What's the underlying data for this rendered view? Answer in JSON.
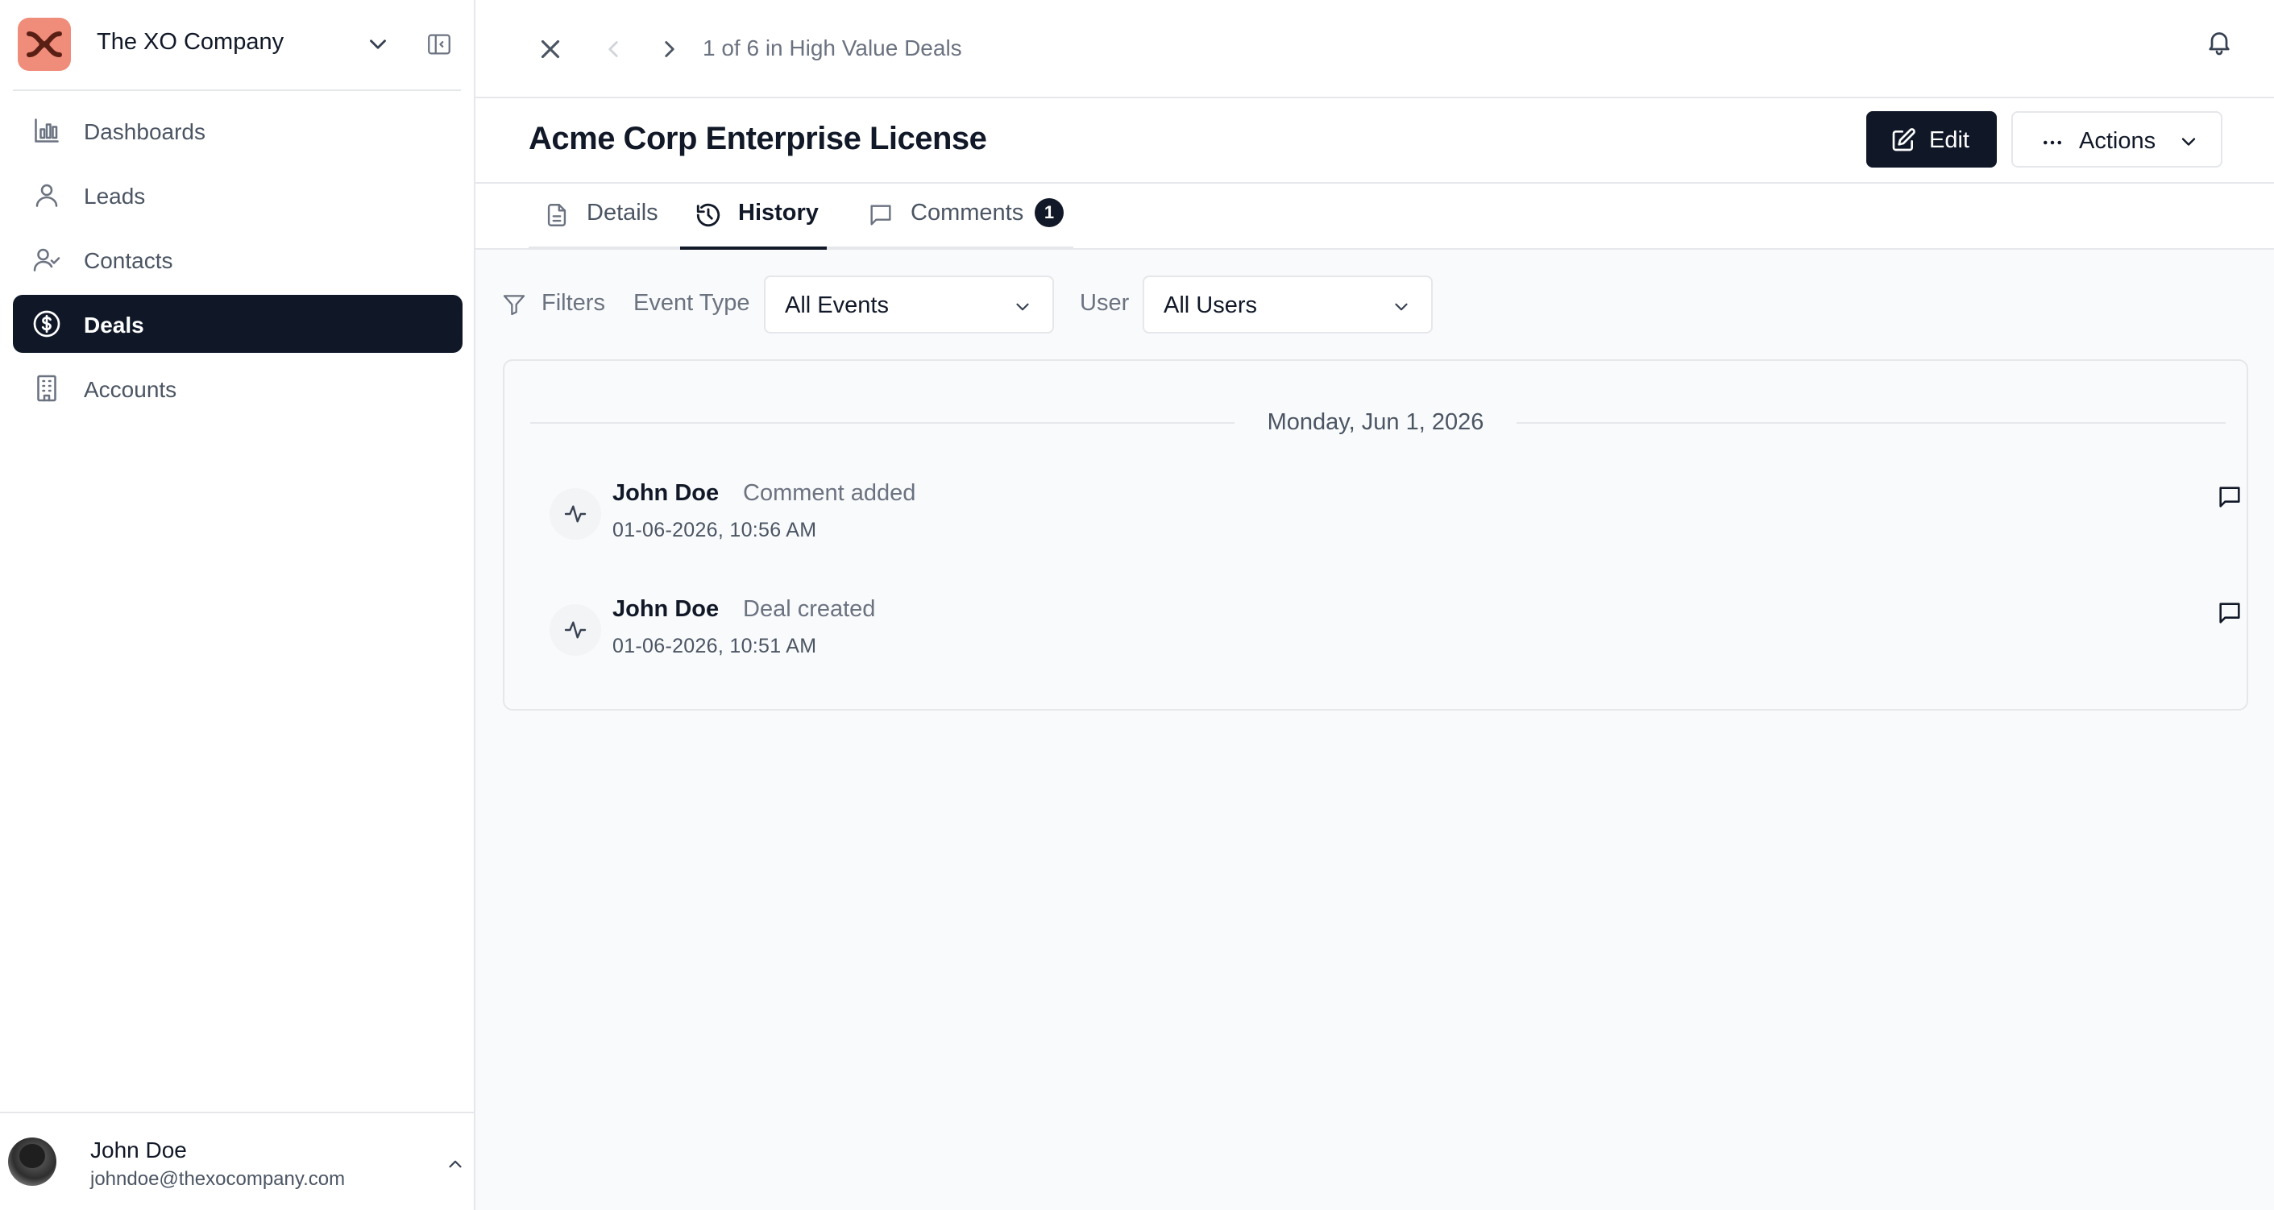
{
  "workspace": {
    "name": "The XO Company"
  },
  "sidebar": {
    "items": [
      {
        "label": "Dashboards",
        "icon": "bar-chart-icon",
        "active": false
      },
      {
        "label": "Leads",
        "icon": "user-icon",
        "active": false
      },
      {
        "label": "Contacts",
        "icon": "user-check-icon",
        "active": false
      },
      {
        "label": "Deals",
        "icon": "dollar-circle-icon",
        "active": true
      },
      {
        "label": "Accounts",
        "icon": "building-icon",
        "active": false
      }
    ]
  },
  "user": {
    "name": "John Doe",
    "email": "johndoe@thexocompany.com"
  },
  "topbar": {
    "record_position": "1 of 6 in High Value Deals"
  },
  "record": {
    "title": "Acme Corp Enterprise License"
  },
  "header_actions": {
    "edit_label": "Edit",
    "actions_label": "Actions"
  },
  "tabs": [
    {
      "label": "Details",
      "icon": "document-icon",
      "active": false
    },
    {
      "label": "History",
      "icon": "history-icon",
      "active": true
    },
    {
      "label": "Comments",
      "icon": "comment-icon",
      "active": false,
      "badge": "1"
    }
  ],
  "filters": {
    "label": "Filters",
    "event_type_label": "Event Type",
    "event_type_value": "All Events",
    "user_label": "User",
    "user_value": "All Users"
  },
  "history": {
    "date": "Monday, Jun 1, 2026",
    "events": [
      {
        "user": "John Doe",
        "action": "Comment added",
        "timestamp": "01-06-2026, 10:56 AM"
      },
      {
        "user": "John Doe",
        "action": "Deal created",
        "timestamp": "01-06-2026, 10:51 AM"
      }
    ]
  },
  "colors": {
    "primary": "#101828",
    "brand": "#f08c7a",
    "border": "#e5e7eb",
    "muted_text": "#6b7280"
  }
}
